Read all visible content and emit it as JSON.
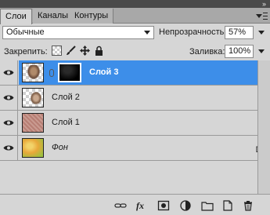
{
  "tabs": [
    {
      "label": "Слои"
    },
    {
      "label": "Каналы"
    },
    {
      "label": "Контуры"
    }
  ],
  "blend": {
    "mode": "Обычные"
  },
  "opacity": {
    "label": "Непрозрачность:",
    "value": "57%"
  },
  "lock": {
    "label": "Закрепить:"
  },
  "fill": {
    "label": "Заливка:",
    "value": "100%"
  },
  "layers": [
    {
      "name": "Слой 3",
      "selected": true
    },
    {
      "name": "Слой 2",
      "selected": false
    },
    {
      "name": "Слой 1",
      "selected": false
    },
    {
      "name": "Фон",
      "selected": false
    }
  ],
  "colors": {
    "selection": "#3d8ee9",
    "panel": "#d6d6d6"
  },
  "icons": [
    "eye-icon",
    "link-layers-icon",
    "fx-icon",
    "add-mask-icon",
    "adjustment-layer-icon",
    "new-group-icon",
    "new-layer-icon",
    "trash-icon",
    "lock-icon"
  ]
}
